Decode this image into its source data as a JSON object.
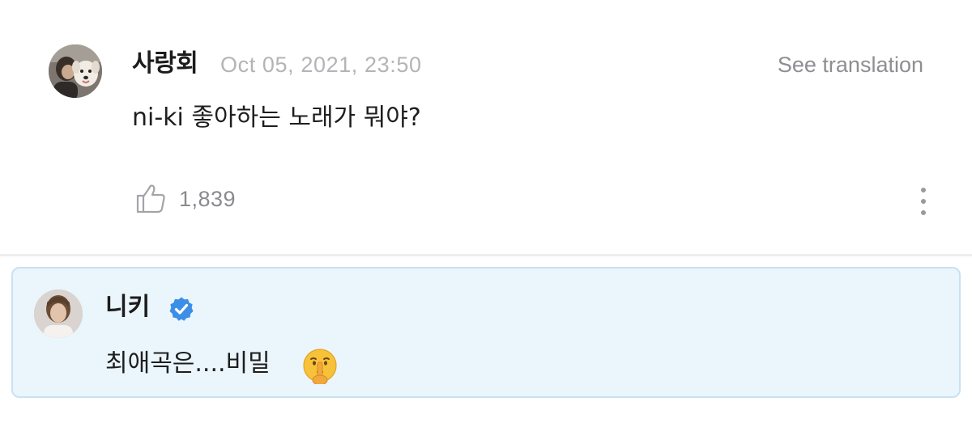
{
  "comment": {
    "author": "사랑회",
    "timestamp": "Oct 05, 2021, 23:50",
    "translate_label": "See translation",
    "text": "ni-ki 좋아하는 노래가 뭐야?",
    "like_count": "1,839",
    "avatar_icon": "user-photo-with-dog",
    "like_icon": "thumbs-up-icon",
    "more_icon": "vertical-ellipsis-icon"
  },
  "reply": {
    "author": "니키",
    "verified_icon": "verified-badge-icon",
    "text": "최애곡은....비밀",
    "emoji": "shushing-face-emoji",
    "avatar_icon": "user-photo"
  },
  "colors": {
    "timestamp": "#b4b4b8",
    "secondary_text": "#8e8e93",
    "verified_blue": "#3b8fe6",
    "reply_background": "#ebf5fc",
    "reply_border": "#c9e1f2",
    "separator": "#ededf0"
  }
}
